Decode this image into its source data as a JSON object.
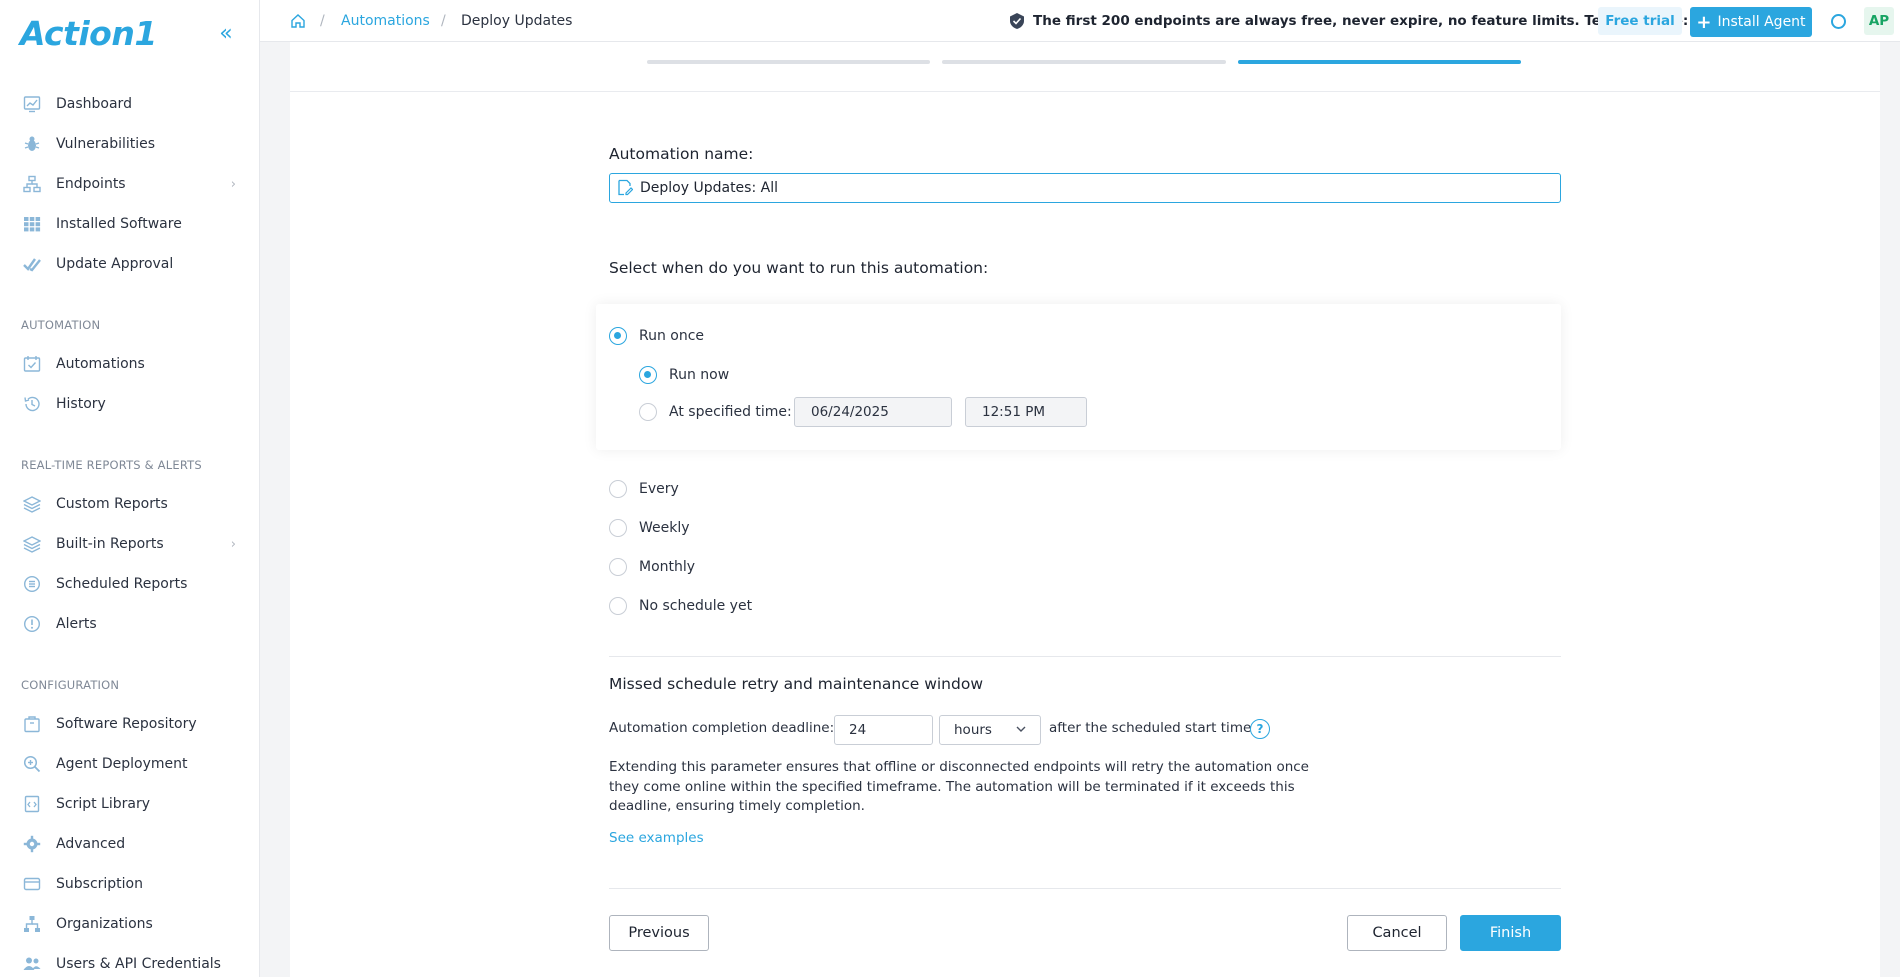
{
  "brand": {
    "logo_text": "Action1",
    "accent": "#2ba6df"
  },
  "sidebar": {
    "collapse_glyph": "«",
    "items": [
      {
        "label": "Dashboard",
        "icon": "chart-icon"
      },
      {
        "label": "Vulnerabilities",
        "icon": "bug-icon"
      },
      {
        "label": "Endpoints",
        "icon": "network-icon",
        "has_submenu": true
      },
      {
        "label": "Installed Software",
        "icon": "grid-icon"
      },
      {
        "label": "Update Approval",
        "icon": "double-check-icon"
      }
    ],
    "sections": [
      {
        "title": "AUTOMATION",
        "items": [
          {
            "label": "Automations",
            "icon": "calendar-check-icon"
          },
          {
            "label": "History",
            "icon": "history-icon"
          }
        ]
      },
      {
        "title": "REAL-TIME REPORTS & ALERTS",
        "items": [
          {
            "label": "Custom Reports",
            "icon": "layers-icon"
          },
          {
            "label": "Built-in Reports",
            "icon": "layers-icon",
            "has_submenu": true
          },
          {
            "label": "Scheduled Reports",
            "icon": "clock-list-icon"
          },
          {
            "label": "Alerts",
            "icon": "alert-icon"
          }
        ]
      },
      {
        "title": "CONFIGURATION",
        "items": [
          {
            "label": "Software Repository",
            "icon": "package-icon"
          },
          {
            "label": "Agent Deployment",
            "icon": "magnify-plus-icon"
          },
          {
            "label": "Script Library",
            "icon": "script-icon"
          },
          {
            "label": "Advanced",
            "icon": "gear-icon"
          },
          {
            "label": "Subscription",
            "icon": "card-icon"
          },
          {
            "label": "Organizations",
            "icon": "org-chart-icon"
          },
          {
            "label": "Users & API Credentials",
            "icon": "users-icon"
          }
        ]
      }
    ]
  },
  "topbar": {
    "breadcrumb": [
      "Automations",
      "Deploy Updates"
    ],
    "promo": "The first 200 endpoints are always free, never expire, no feature limits. Test on more:",
    "free_trial": "Free trial",
    "install_agent": "Install Agent",
    "avatar_initials": "AP"
  },
  "wizard": {
    "steps_active_index": 2,
    "automation_name_label": "Automation name:",
    "automation_name_value": "Deploy Updates: All",
    "schedule_heading": "Select when do you want to run this automation:",
    "run_once": "Run once",
    "run_now": "Run now",
    "at_specified_time": "At specified time:",
    "date_value": "06/24/2025",
    "time_value": "12:51 PM",
    "options": [
      "Every",
      "Weekly",
      "Monthly",
      "No schedule yet"
    ],
    "selected": "Run once",
    "sub_selected": "Run now",
    "retry_heading": "Missed schedule retry and maintenance window",
    "deadline_label": "Automation completion deadline:",
    "deadline_value": "24",
    "deadline_unit": "hours",
    "deadline_suffix": "after the scheduled start time",
    "help_glyph": "?",
    "description": "Extending this parameter ensures that offline or disconnected endpoints will retry the automation once they come online within the specified timeframe. The automation will be terminated if it exceeds this deadline, ensuring timely completion.",
    "see_examples": "See examples",
    "previous": "Previous",
    "cancel": "Cancel",
    "finish": "Finish"
  }
}
